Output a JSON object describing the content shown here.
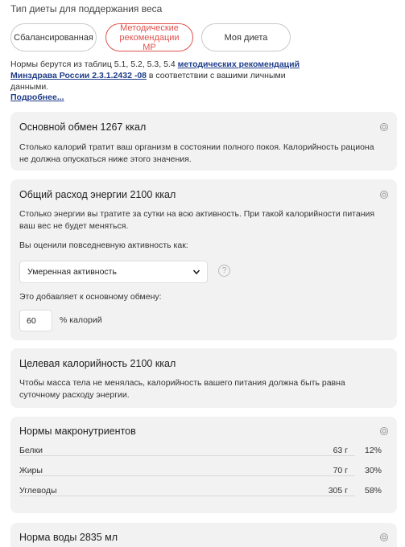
{
  "diet_type": {
    "title": "Тип диеты для поддержания веса",
    "options": [
      {
        "label": "Сбалансированная",
        "active": false
      },
      {
        "label": "Методические рекомендации МР",
        "active": true
      },
      {
        "label": "Моя диета",
        "active": false
      }
    ]
  },
  "norms_note": {
    "prefix": "Нормы берутся из таблиц 5.1, 5.2, 5.3, 5.4 ",
    "link": "методических рекомендаций Минздрава России 2.3.1.2432 -08",
    "suffix": " в соответствии с вашими личными данными.",
    "more": "Подробнее..."
  },
  "bmr_card": {
    "title": "Основной обмен 1267 ккал",
    "text": "Столько калорий тратит ваш организм в состоянии полного покоя. Калорийность рациона не должна опускаться ниже этого значения.",
    "icon": "gear-icon"
  },
  "energy_card": {
    "title": "Общий расход энергии 2100 ккал",
    "text": "Столько энергии вы тратите за сутки на всю активность. При такой калорийности питания ваш вес не будет меняться.",
    "activity_label": "Вы оценили повседневную активность как:",
    "activity_value": "Умеренная активность",
    "adds_label": "Это добавляет к основному обмену:",
    "adds_value": "60",
    "adds_unit": "% калорий",
    "help": "?"
  },
  "target_card": {
    "title": "Целевая калорийность 2100 ккал",
    "text": "Чтобы масса тела не менялась, калорийность вашего питания должна быть равна суточному расходу энергии."
  },
  "macros_card": {
    "title": "Нормы макронутриентов",
    "rows": [
      {
        "name": "Белки",
        "grams": "63 г",
        "pct": "12%"
      },
      {
        "name": "Жиры",
        "grams": "70 г",
        "pct": "30%"
      },
      {
        "name": "Углеводы",
        "grams": "305 г",
        "pct": "58%"
      }
    ]
  },
  "water_card": {
    "title": "Норма воды 2835 мл"
  },
  "colors": {
    "accent": "#e0524c",
    "link": "#1f3d8a",
    "card_bg": "#f2f2f2"
  }
}
